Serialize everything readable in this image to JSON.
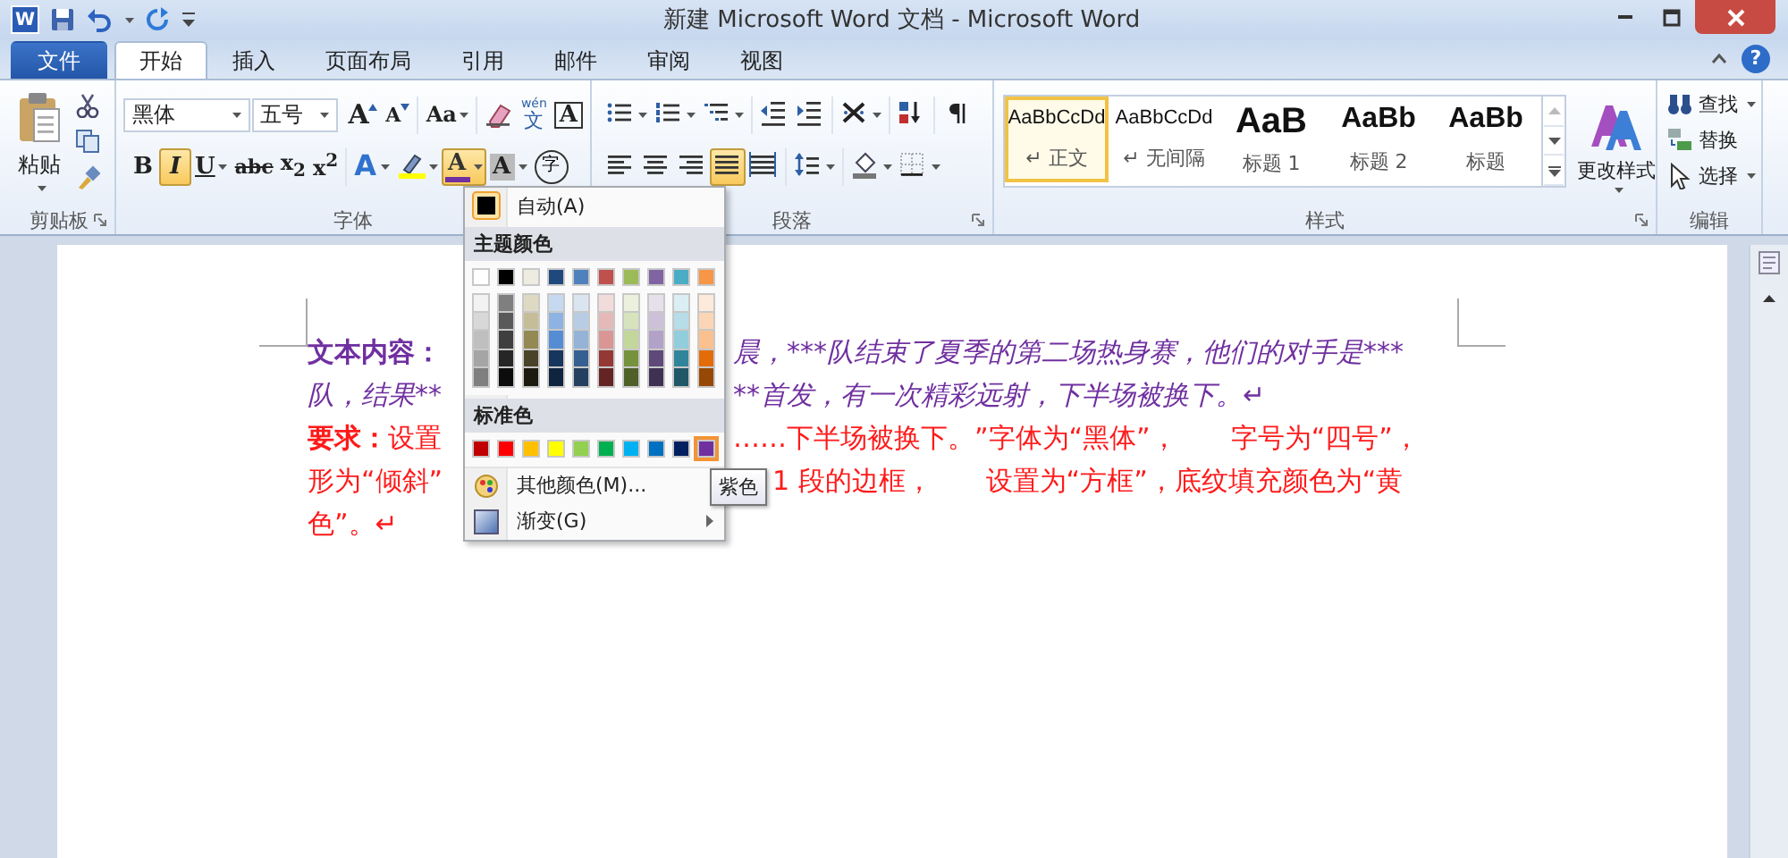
{
  "title_bar": {
    "app_letter": "W",
    "title": "新建 Microsoft Word 文档 - Microsoft Word"
  },
  "ribbon_tabs": [
    {
      "label": "文件",
      "kind": "file",
      "selected": false
    },
    {
      "label": "开始",
      "kind": "tab",
      "selected": true
    },
    {
      "label": "插入",
      "kind": "tab",
      "selected": false
    },
    {
      "label": "页面布局",
      "kind": "tab",
      "selected": false
    },
    {
      "label": "引用",
      "kind": "tab",
      "selected": false
    },
    {
      "label": "邮件",
      "kind": "tab",
      "selected": false
    },
    {
      "label": "审阅",
      "kind": "tab",
      "selected": false
    },
    {
      "label": "视图",
      "kind": "tab",
      "selected": false
    }
  ],
  "help": "?",
  "clipboard": {
    "paste": "粘贴",
    "label": "剪贴板"
  },
  "font": {
    "font_name": "黑体",
    "font_size": "五号",
    "label": "字体",
    "row1": [
      [
        {
          "kind": "grow",
          "label": "A",
          "selected": false
        },
        {
          "kind": "shrink",
          "label": "A",
          "selected": false
        }
      ],
      [
        {
          "kind": "case",
          "label": "Aa",
          "selected": false
        }
      ],
      [
        {
          "kind": "clear",
          "selected": false
        },
        {
          "kind": "phonetic",
          "ruby": "wén",
          "label": "文",
          "selected": false
        },
        {
          "kind": "border",
          "label": "A",
          "selected": false
        }
      ]
    ],
    "row2": [
      [
        {
          "kind": "bold",
          "label": "B",
          "selected": false
        },
        {
          "kind": "italic",
          "label": "I",
          "selected": true
        },
        {
          "kind": "underline",
          "label": "U",
          "selected": false
        },
        {
          "kind": "strike",
          "label": "abc",
          "selected": false
        },
        {
          "kind": "subscript",
          "label": "x$_{2}$",
          "selected": false
        },
        {
          "kind": "superscript",
          "label": "x$^{2}$",
          "selected": false
        }
      ],
      [
        {
          "kind": "effects",
          "label": "A",
          "selected": false
        },
        {
          "kind": "highlight",
          "selected": false
        },
        {
          "kind": "font-color",
          "label": "A",
          "selected": true
        },
        {
          "kind": "shading",
          "label": "A",
          "selected": false
        },
        {
          "kind": "enclose",
          "label": "字",
          "selected": false
        }
      ]
    ]
  },
  "paragraph": {
    "label": "段落",
    "row1": [
      [
        {
          "kind": "bullets",
          "selected": false
        },
        {
          "kind": "numbering",
          "selected": false
        },
        {
          "kind": "multilevel",
          "selected": false
        }
      ],
      [
        {
          "kind": "outdent",
          "selected": false
        },
        {
          "kind": "indent",
          "selected": false
        }
      ],
      [
        {
          "kind": "asian-layout",
          "selected": false
        }
      ],
      [
        {
          "kind": "sort",
          "selected": false
        }
      ],
      [
        {
          "kind": "marks",
          "selected": false
        }
      ]
    ],
    "row2": [
      [
        {
          "kind": "align-left",
          "selected": false
        },
        {
          "kind": "align-center",
          "selected": false
        },
        {
          "kind": "align-right",
          "selected": false
        },
        {
          "kind": "justify",
          "selected": true
        },
        {
          "kind": "distributed",
          "selected": false
        }
      ],
      [
        {
          "kind": "line-spacing",
          "selected": false
        }
      ],
      [
        {
          "kind": "shading",
          "selected": false
        },
        {
          "kind": "borders",
          "selected": false
        }
      ]
    ]
  },
  "styles": {
    "label": "样式",
    "change_styles": "更改样式",
    "items": [
      {
        "kind": "normal",
        "preview": "AaBbCcDd",
        "label": "↵ 正文",
        "selected": true
      },
      {
        "kind": "no-spacing",
        "preview": "AaBbCcDd",
        "label": "↵ 无间隔",
        "selected": false
      },
      {
        "kind": "heading-1",
        "preview": "AaB",
        "label": "标题 1",
        "selected": false
      },
      {
        "kind": "heading-2",
        "preview": "AaBb",
        "label": "标题 2",
        "selected": false
      },
      {
        "kind": "title",
        "preview": "AaBb",
        "label": "标题",
        "selected": false
      }
    ]
  },
  "editing": {
    "label": "编辑",
    "items": [
      {
        "kind": "find",
        "label": "查找"
      },
      {
        "kind": "replace",
        "label": "替换"
      },
      {
        "kind": "select",
        "label": "选择"
      }
    ]
  },
  "color_menu": {
    "auto": "自动(A)",
    "theme_heading": "主题颜色",
    "theme_colors": [
      {
        "color": "#ffffff",
        "selected": false,
        "shades": [
          {
            "color": "#f2f2f2",
            "selected": false
          },
          {
            "color": "#d8d8d8",
            "selected": false
          },
          {
            "color": "#bfbfbf",
            "selected": false
          },
          {
            "color": "#a5a5a5",
            "selected": false
          },
          {
            "color": "#7f7f7f",
            "selected": false
          }
        ]
      },
      {
        "color": "#000000",
        "selected": false,
        "shades": [
          {
            "color": "#7f7f7f",
            "selected": false
          },
          {
            "color": "#595959",
            "selected": false
          },
          {
            "color": "#3f3f3f",
            "selected": false
          },
          {
            "color": "#262626",
            "selected": false
          },
          {
            "color": "#0c0c0c",
            "selected": false
          }
        ]
      },
      {
        "color": "#eeece1",
        "selected": false,
        "shades": [
          {
            "color": "#ddd9c3",
            "selected": false
          },
          {
            "color": "#c4bd97",
            "selected": false
          },
          {
            "color": "#938953",
            "selected": false
          },
          {
            "color": "#494429",
            "selected": false
          },
          {
            "color": "#1d1b10",
            "selected": false
          }
        ]
      },
      {
        "color": "#1f497d",
        "selected": false,
        "shades": [
          {
            "color": "#c6d9f0",
            "selected": false
          },
          {
            "color": "#8db3e2",
            "selected": false
          },
          {
            "color": "#548dd4",
            "selected": false
          },
          {
            "color": "#17365d",
            "selected": false
          },
          {
            "color": "#0f243e",
            "selected": false
          }
        ]
      },
      {
        "color": "#4f81bd",
        "selected": false,
        "shades": [
          {
            "color": "#dbe5f1",
            "selected": false
          },
          {
            "color": "#b8cce4",
            "selected": false
          },
          {
            "color": "#95b3d7",
            "selected": false
          },
          {
            "color": "#366092",
            "selected": false
          },
          {
            "color": "#244061",
            "selected": false
          }
        ]
      },
      {
        "color": "#c0504d",
        "selected": false,
        "shades": [
          {
            "color": "#f2dcdb",
            "selected": false
          },
          {
            "color": "#e5b9b7",
            "selected": false
          },
          {
            "color": "#d99694",
            "selected": false
          },
          {
            "color": "#953734",
            "selected": false
          },
          {
            "color": "#632423",
            "selected": false
          }
        ]
      },
      {
        "color": "#9bbb59",
        "selected": false,
        "shades": [
          {
            "color": "#ebf1dd",
            "selected": false
          },
          {
            "color": "#d7e3bc",
            "selected": false
          },
          {
            "color": "#c3d69b",
            "selected": false
          },
          {
            "color": "#76923c",
            "selected": false
          },
          {
            "color": "#4f6128",
            "selected": false
          }
        ]
      },
      {
        "color": "#8064a2",
        "selected": false,
        "shades": [
          {
            "color": "#e5e0ec",
            "selected": false
          },
          {
            "color": "#ccc1d9",
            "selected": false
          },
          {
            "color": "#b2a2c7",
            "selected": false
          },
          {
            "color": "#5f497a",
            "selected": false
          },
          {
            "color": "#3f3151",
            "selected": false
          }
        ]
      },
      {
        "color": "#4bacc6",
        "selected": false,
        "shades": [
          {
            "color": "#dbeef3",
            "selected": false
          },
          {
            "color": "#b7dde8",
            "selected": false
          },
          {
            "color": "#92cddc",
            "selected": false
          },
          {
            "color": "#31859b",
            "selected": false
          },
          {
            "color": "#205867",
            "selected": false
          }
        ]
      },
      {
        "color": "#f79646",
        "selected": false,
        "shades": [
          {
            "color": "#fdeada",
            "selected": false
          },
          {
            "color": "#fbd5b5",
            "selected": false
          },
          {
            "color": "#fac08f",
            "selected": false
          },
          {
            "color": "#e36c09",
            "selected": false
          },
          {
            "color": "#974806",
            "selected": false
          }
        ]
      }
    ],
    "standard_heading": "标准色",
    "standard_colors": [
      {
        "color": "#c00000",
        "selected": false
      },
      {
        "color": "#ff0000",
        "selected": false
      },
      {
        "color": "#ffc000",
        "selected": false
      },
      {
        "color": "#ffff00",
        "selected": false
      },
      {
        "color": "#92d050",
        "selected": false
      },
      {
        "color": "#00b050",
        "selected": false
      },
      {
        "color": "#00b0f0",
        "selected": false
      },
      {
        "color": "#0070c0",
        "selected": false
      },
      {
        "color": "#002060",
        "selected": false
      },
      {
        "color": "#7030a0",
        "selected": true
      }
    ],
    "more": "其他颜色(M)...",
    "gradient": "渐变(G)",
    "tooltip": "紫色"
  },
  "document": {
    "paragraphs": [
      {
        "kind": "content",
        "lines": [
          {
            "lead": "文本内容：",
            "right": "晨，***队结束了夏季的第二场热身赛，他们的对手是***"
          },
          {
            "left": "队，结果**",
            "right": "**首发，有一次精彩远射，下半场被换下。↵"
          }
        ]
      },
      {
        "kind": "requirement",
        "lines": [
          {
            "lead": "要求：",
            "left": "设置",
            "right": "……下半场被换下。”字体为“黑体”，　　字号为“四号”，"
          },
          {
            "left": "形为“倾斜”",
            "right": "1 段的边框，　　设置为“方框”，底纹填充颜色为“黄"
          },
          {
            "left": "色”。↵"
          }
        ]
      }
    ]
  }
}
